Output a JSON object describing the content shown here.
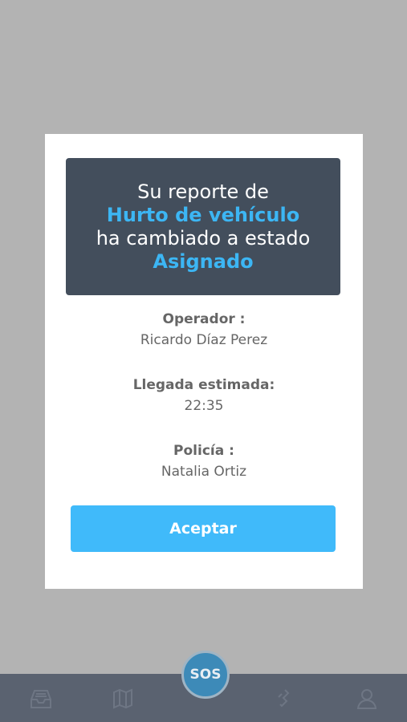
{
  "dialog": {
    "line1": "Su reporte de",
    "report_type": "Hurto de vehículo",
    "line3": "ha cambiado a estado",
    "status": "Asignado",
    "fields": [
      {
        "label": "Operador :",
        "value": "Ricardo Díaz Perez"
      },
      {
        "label": "Llegada estimada:",
        "value": "22:35"
      },
      {
        "label": "Policía :",
        "value": "Natalia Ortiz"
      }
    ],
    "accept_label": "Aceptar"
  },
  "navbar": {
    "sos_label": "SOS",
    "icons": [
      "inbox-icon",
      "map-icon",
      "chat-icon",
      "user-icon"
    ]
  },
  "colors": {
    "accent": "#3cb6f4",
    "banner": "#434e5c",
    "overlay": "#b3b3b3",
    "navbar": "#5a6270"
  }
}
